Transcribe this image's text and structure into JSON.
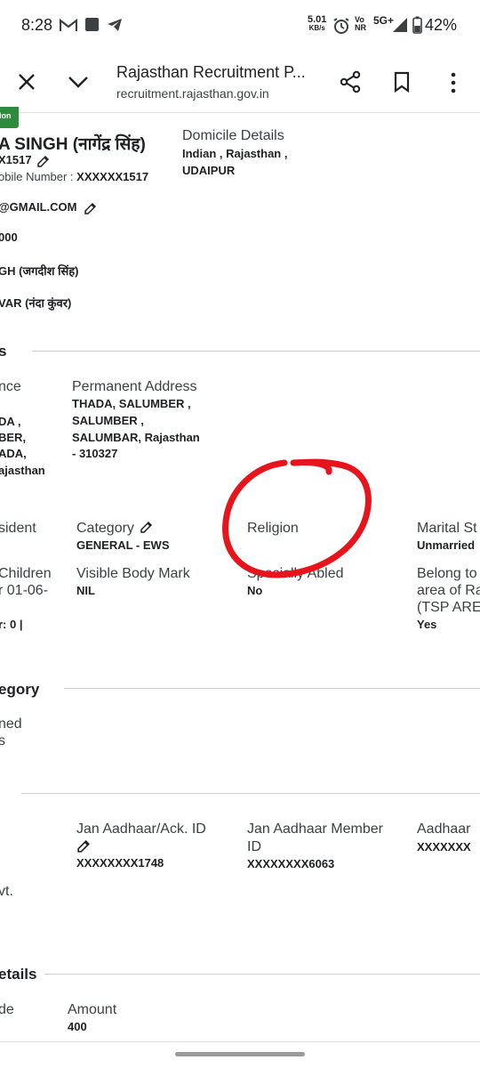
{
  "status_bar": {
    "time": "8:28",
    "net_speed_value": "5.01",
    "net_speed_unit": "KB/s",
    "volte_top": "Vo",
    "volte_bottom": "NR",
    "network": "5G+",
    "battery": "42%"
  },
  "toolbar": {
    "title": "Rajasthan Recruitment P...",
    "url": "recruitment.rajasthan.gov.in"
  },
  "profile": {
    "badge": "sion",
    "name": "A SINGH (नागेंद्र सिंह)",
    "id_partial": "X1517",
    "mobile_label": "obile Number : ",
    "mobile_value": "XXXXXX1517",
    "email": "@GMAIL.COM",
    "dob_partial": "000",
    "father": "GH (जगदीश सिंह)",
    "mother": "VAR (नंदा कुंवर)",
    "domicile_label": "Domicile Details",
    "domicile_line1": "Indian , Rajasthan ,",
    "domicile_line2": "UDAIPUR"
  },
  "address_section": {
    "heading": "s",
    "residence_label": "nce",
    "residence_lines": [
      "DA ,",
      "BER,",
      "ADA,",
      "ajasthan"
    ],
    "permanent_label": "Permanent Address",
    "permanent_lines": [
      "THADA, SALUMBER ,",
      "SALUMBER ,",
      "SALUMBAR, Rajasthan",
      "- 310327"
    ]
  },
  "details": {
    "resident_label": "sident",
    "category_label": "Category",
    "category_value": "GENERAL - EWS",
    "religion_label": "Religion",
    "marital_label": "Marital St",
    "marital_value": "Unmarried",
    "children_label_1": "Children",
    "children_label_2": "r 01-06-",
    "children_value": "r: 0 |",
    "body_mark_label": "Visible Body Mark",
    "body_mark_value": "NIL",
    "specially_abled_label": "Specially Abled",
    "specially_abled_value": "No",
    "belong_label_1": "Belong to",
    "belong_label_2": "area of Ra",
    "belong_label_3": "(TSP ARE",
    "belong_value": "Yes"
  },
  "category_section": {
    "heading": "egory",
    "line1": "ned",
    "line2": "s"
  },
  "aadhaar_section": {
    "govt_partial": "vt.",
    "jan_ack_label": "Jan Aadhaar/Ack. ID",
    "jan_ack_value": "XXXXXXXX1748",
    "jan_member_label_1": "Jan Aadhaar Member",
    "jan_member_label_2": "ID",
    "jan_member_value": "XXXXXXXX6063",
    "aadhaar_label": "Aadhaar",
    "aadhaar_value": "XXXXXXX"
  },
  "fee_section": {
    "heading": "etails",
    "code_label": "de",
    "amount_label": "Amount",
    "amount_value": "400"
  },
  "colors": {
    "annotation": "#e8141b",
    "badge": "#2e8b3e"
  }
}
